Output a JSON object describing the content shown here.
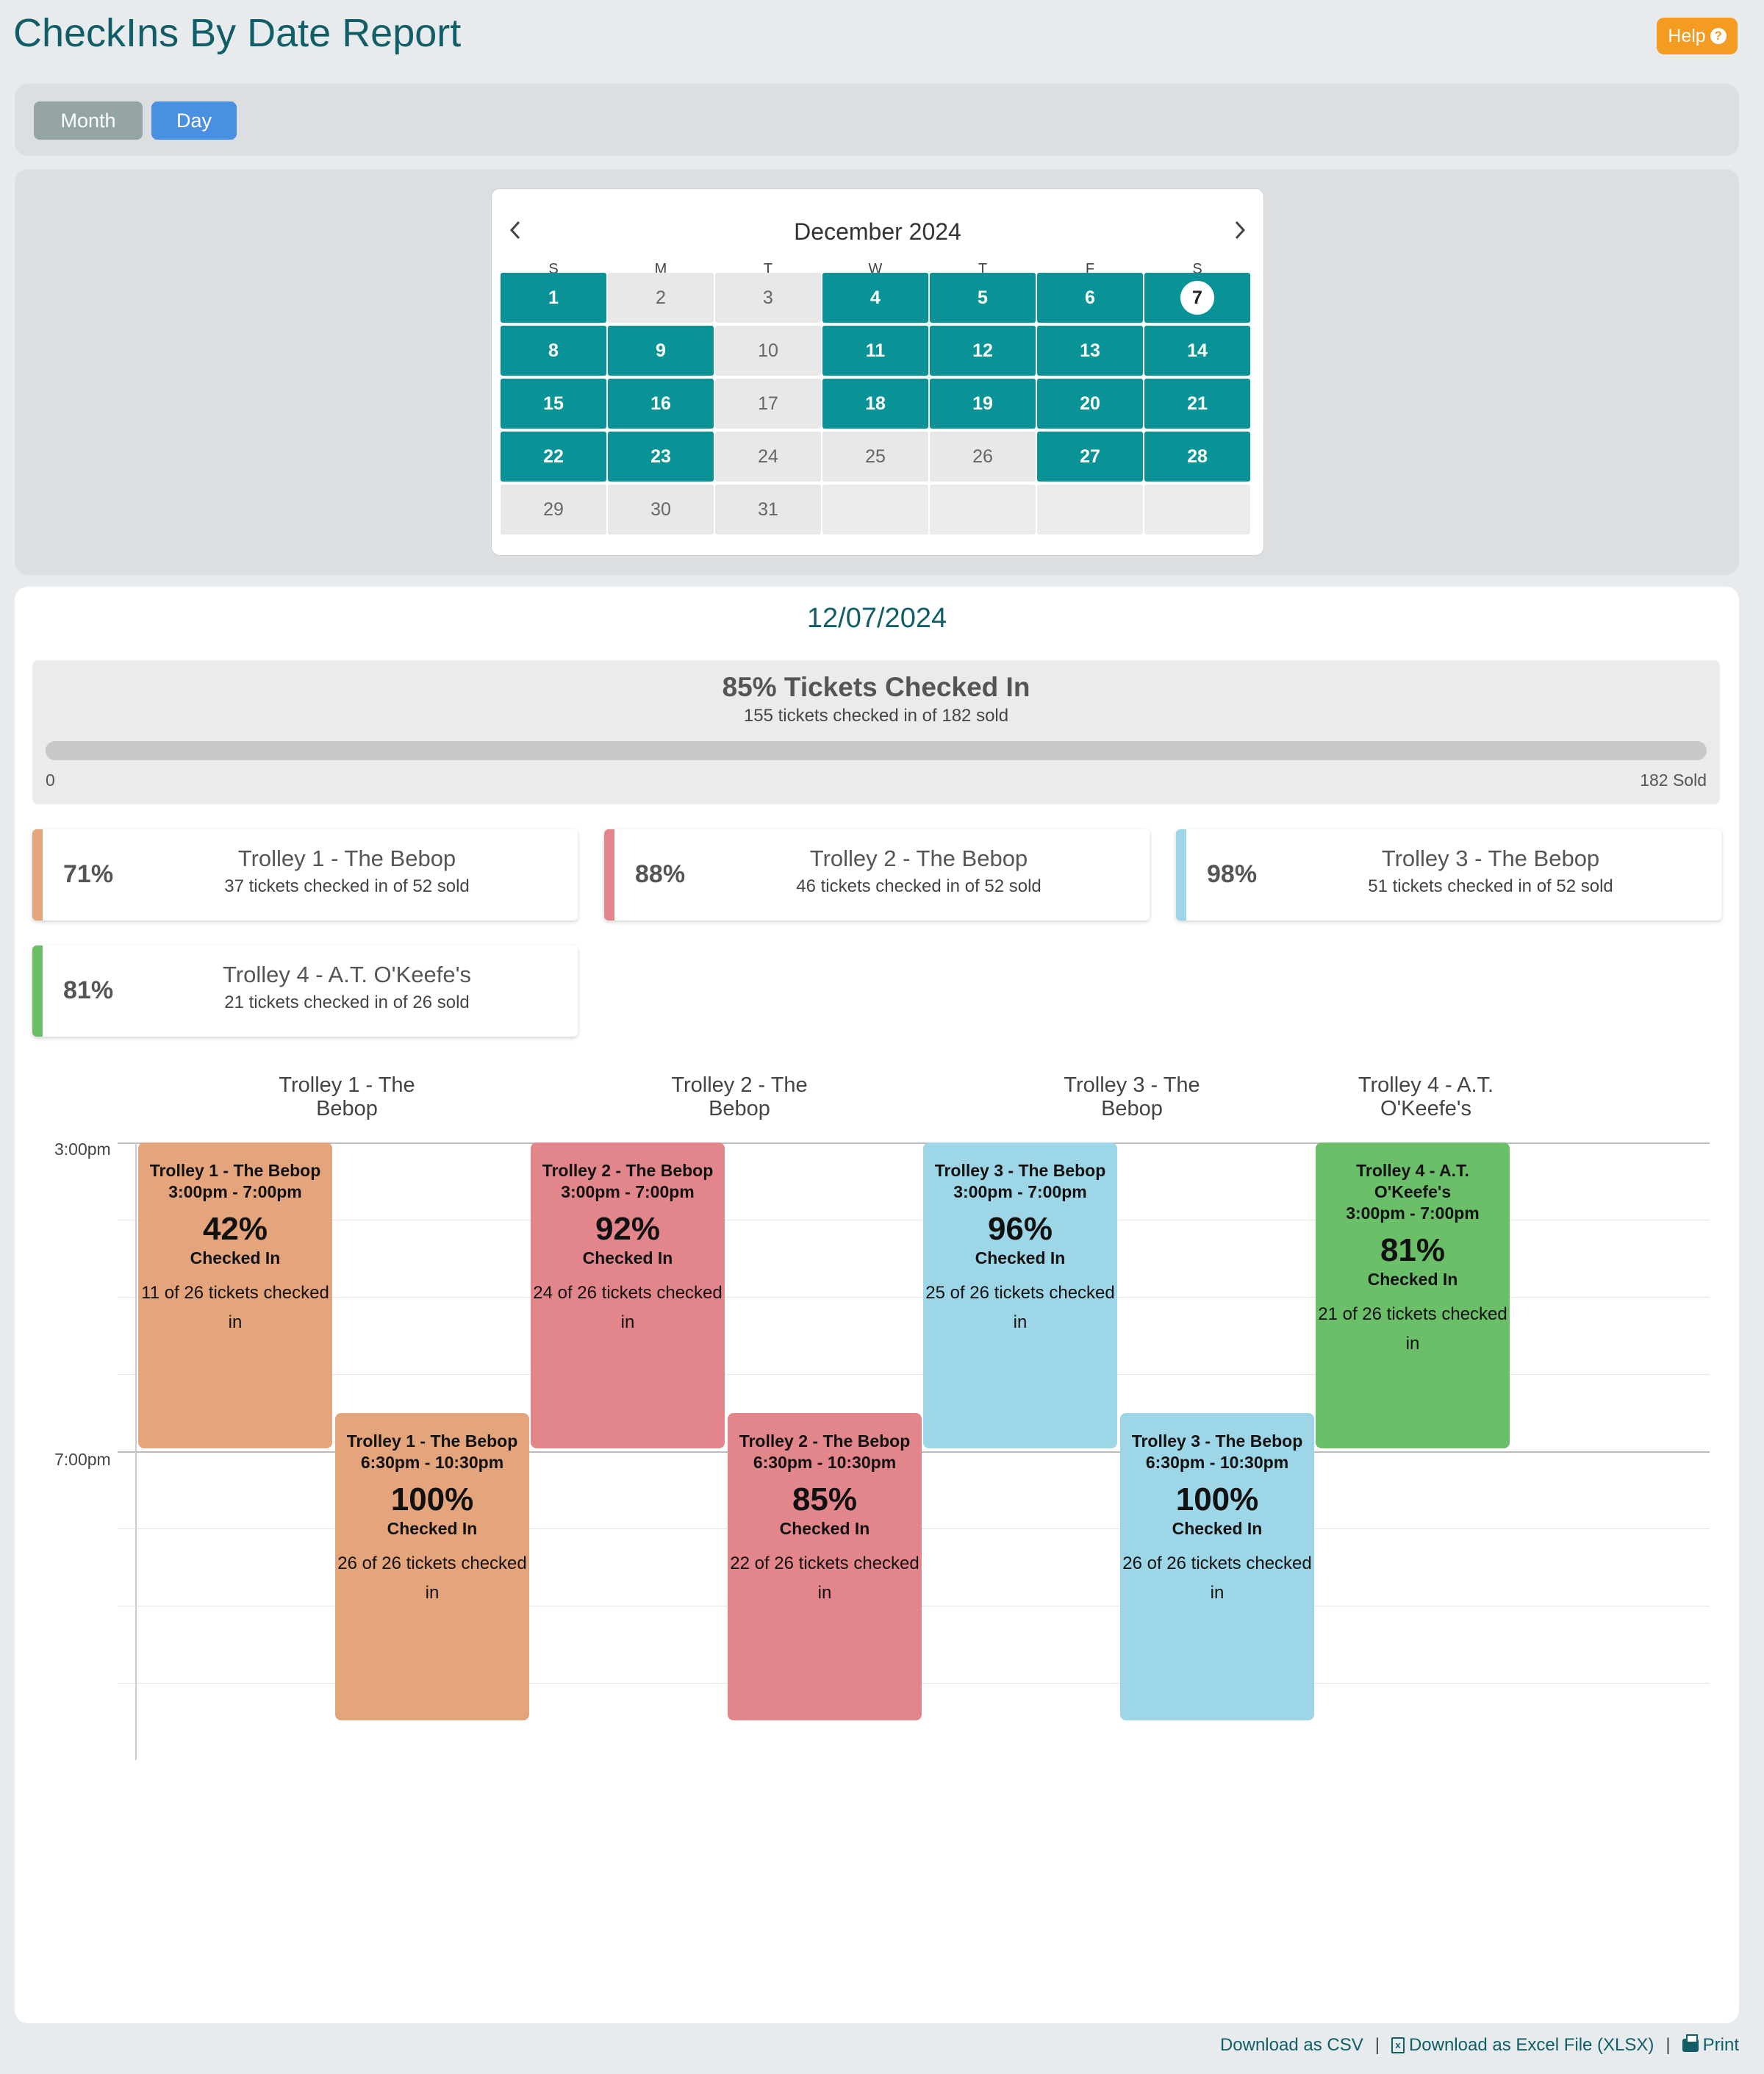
{
  "page": {
    "title": "CheckIns By Date Report"
  },
  "help": {
    "label": "Help",
    "icon": "question-circle-icon",
    "color": "#f39c21"
  },
  "view_toggle": {
    "month_label": "Month",
    "day_label": "Day",
    "selected": "Day"
  },
  "calendar": {
    "month_label": "December 2024",
    "prev_icon": "chevron-left-icon",
    "next_icon": "chevron-right-icon",
    "weekdays": [
      "S",
      "M",
      "T",
      "W",
      "T",
      "F",
      "S"
    ],
    "selected_day": "7",
    "active_color": "#0a9396",
    "weeks": [
      [
        {
          "d": "1",
          "a": true
        },
        {
          "d": "2",
          "a": false
        },
        {
          "d": "3",
          "a": false
        },
        {
          "d": "4",
          "a": true
        },
        {
          "d": "5",
          "a": true
        },
        {
          "d": "6",
          "a": true
        },
        {
          "d": "7",
          "a": true
        }
      ],
      [
        {
          "d": "8",
          "a": true
        },
        {
          "d": "9",
          "a": true
        },
        {
          "d": "10",
          "a": false
        },
        {
          "d": "11",
          "a": true
        },
        {
          "d": "12",
          "a": true
        },
        {
          "d": "13",
          "a": true
        },
        {
          "d": "14",
          "a": true
        }
      ],
      [
        {
          "d": "15",
          "a": true
        },
        {
          "d": "16",
          "a": true
        },
        {
          "d": "17",
          "a": false
        },
        {
          "d": "18",
          "a": true
        },
        {
          "d": "19",
          "a": true
        },
        {
          "d": "20",
          "a": true
        },
        {
          "d": "21",
          "a": true
        }
      ],
      [
        {
          "d": "22",
          "a": true
        },
        {
          "d": "23",
          "a": true
        },
        {
          "d": "24",
          "a": false
        },
        {
          "d": "25",
          "a": false
        },
        {
          "d": "26",
          "a": false
        },
        {
          "d": "27",
          "a": true
        },
        {
          "d": "28",
          "a": true
        }
      ],
      [
        {
          "d": "29",
          "a": false
        },
        {
          "d": "30",
          "a": false
        },
        {
          "d": "31",
          "a": false
        },
        {
          "d": "",
          "a": false
        },
        {
          "d": "",
          "a": false
        },
        {
          "d": "",
          "a": false
        },
        {
          "d": "",
          "a": false
        }
      ]
    ]
  },
  "report": {
    "date": "12/07/2024",
    "summary": {
      "title": "85% Tickets Checked In",
      "subtitle": "155 tickets checked in of 182 sold",
      "min_label": "0",
      "max_label": "182 Sold",
      "progress_fraction": 0.85
    },
    "trolleys": [
      {
        "pct": "71%",
        "name": "Trolley 1 - The Bebop",
        "detail": "37 tickets checked in of 52 sold",
        "color": "#e5a57c"
      },
      {
        "pct": "88%",
        "name": "Trolley 2 - The Bebop",
        "detail": "46 tickets checked in of 52 sold",
        "color": "#e2868c"
      },
      {
        "pct": "98%",
        "name": "Trolley 3 - The Bebop",
        "detail": "51 tickets checked in of 52 sold",
        "color": "#9dd6e6"
      },
      {
        "pct": "81%",
        "name": "Trolley 4 - A.T. O'Keefe's",
        "detail": "21 tickets checked in of 26 sold",
        "color": "#6bbf69"
      }
    ],
    "schedule": {
      "columns": [
        "Trolley 1 - The Bebop",
        "Trolley 2 - The Bebop",
        "Trolley 3 - The Bebop",
        "Trolley 4 - A.T. O'Keefe's"
      ],
      "time_labels": [
        "3:00pm",
        "7:00pm"
      ],
      "events": [
        {
          "title": "Trolley 1 - The Bebop",
          "time": "3:00pm - 7:00pm",
          "pct": "42%",
          "label": "Checked In",
          "count": "11 of 26 tickets checked in",
          "color": "#e5a57c"
        },
        {
          "title": "Trolley 1 - The Bebop",
          "time": "6:30pm - 10:30pm",
          "pct": "100%",
          "label": "Checked In",
          "count": "26 of 26 tickets checked in",
          "color": "#e5a57c"
        },
        {
          "title": "Trolley 2 - The Bebop",
          "time": "3:00pm - 7:00pm",
          "pct": "92%",
          "label": "Checked In",
          "count": "24 of 26 tickets checked in",
          "color": "#e2868c"
        },
        {
          "title": "Trolley 2 - The Bebop",
          "time": "6:30pm - 10:30pm",
          "pct": "85%",
          "label": "Checked In",
          "count": "22 of 26 tickets checked in",
          "color": "#e2868c"
        },
        {
          "title": "Trolley 3 - The Bebop",
          "time": "3:00pm - 7:00pm",
          "pct": "96%",
          "label": "Checked In",
          "count": "25 of 26 tickets checked in",
          "color": "#9dd6e6"
        },
        {
          "title": "Trolley 3 - The Bebop",
          "time": "6:30pm - 10:30pm",
          "pct": "100%",
          "label": "Checked In",
          "count": "26 of 26 tickets checked in",
          "color": "#9dd6e6"
        },
        {
          "title": "Trolley 4 - A.T. O'Keefe's",
          "time": "3:00pm - 7:00pm",
          "pct": "81%",
          "label": "Checked In",
          "count": "21 of 26 tickets checked in",
          "color": "#6bbf69"
        }
      ]
    }
  },
  "footer": {
    "csv_label": "Download as CSV",
    "xlsx_label": "Download as Excel File (XLSX)",
    "print_label": "Print",
    "separator": "|"
  }
}
